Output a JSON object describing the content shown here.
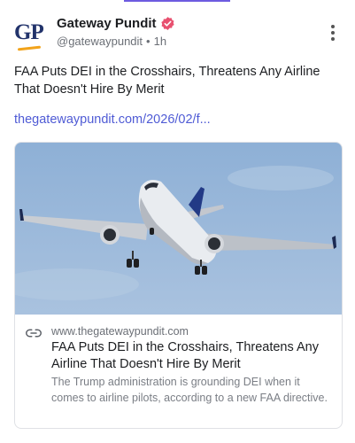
{
  "account": {
    "avatar_text": "GP",
    "name": "Gateway Pundit",
    "handle": "@gatewaypundit",
    "separator": "•",
    "time": "1h",
    "verified_icon": "verified-badge-icon",
    "verified_color": "#e8506f"
  },
  "post": {
    "text": "FAA Puts DEI in the Crosshairs, Threatens Any Airline That Doesn't Hire By Merit",
    "link": "thegatewaypundit.com/2026/02/f..."
  },
  "card": {
    "image_icon": "airplane-photo",
    "link_icon": "link-icon",
    "domain": "www.thegatewaypundit.com",
    "title": "FAA Puts DEI in the Crosshairs, Threatens Any Airline That Doesn't Hire By Merit",
    "description": "The Trump administration is grounding DEI when it comes to airline pilots, according to a new FAA directive."
  },
  "colors": {
    "link": "#4f5bd5",
    "brand_blue": "#22336b",
    "brand_orange": "#f2a31a",
    "top_accent": "#6d5be0"
  }
}
